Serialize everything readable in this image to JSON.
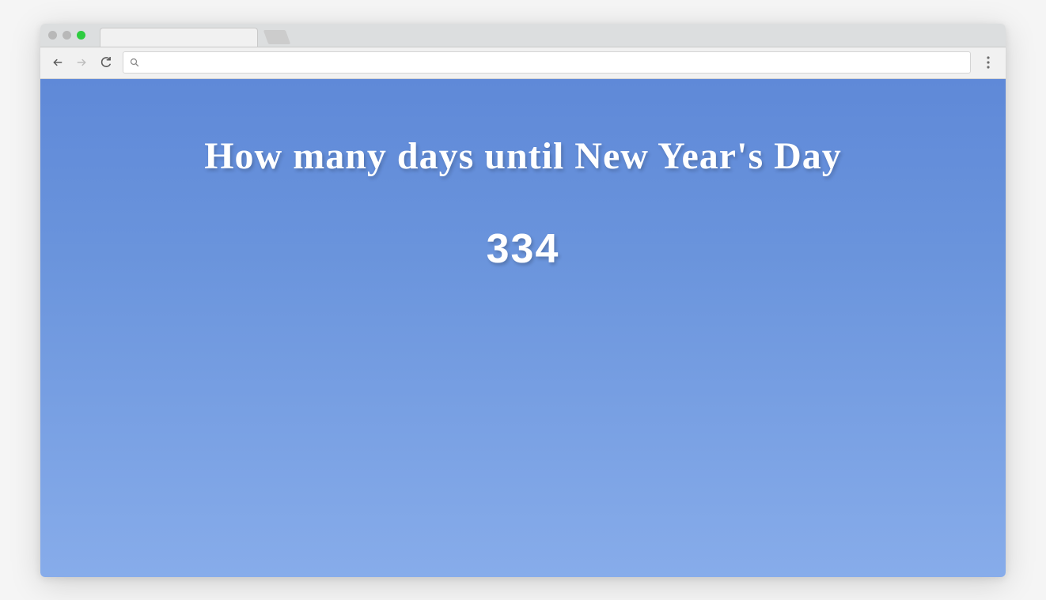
{
  "browser": {
    "url_value": "",
    "url_placeholder": ""
  },
  "page": {
    "headline": "How many days until New Year's Day",
    "days_remaining": "334"
  },
  "colors": {
    "gradient_top": "#5f89d8",
    "gradient_bottom": "#87acea",
    "text": "#ffffff"
  }
}
